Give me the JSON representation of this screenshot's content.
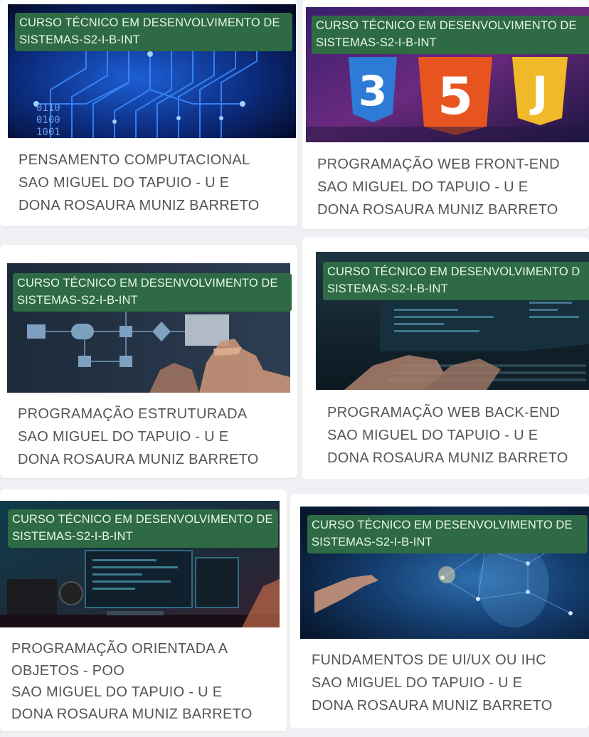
{
  "courses": [
    {
      "badge_line1": "CURSO TÉCNICO EM DESENVOLVIMENTO DE",
      "badge_line2": "SISTEMAS-S2-I-B-INT",
      "title": "PENSAMENTO COMPUTACIONAL",
      "school_line1": "SAO MIGUEL DO TAPUIO - U E",
      "school_line2": "DONA ROSAURA MUNIZ BARRETO",
      "image_overlay_text": "0110 0100 1001",
      "image_icon": "circuit-board-image"
    },
    {
      "badge_line1": "CURSO TÉCNICO EM DESENVOLVIMENTO DE",
      "badge_line2": "SISTEMAS-S2-I-B-INT",
      "title": "PROGRAMAÇÃO WEB FRONT-END",
      "school_line1": "SAO MIGUEL DO TAPUIO - U E",
      "school_line2": "DONA ROSAURA MUNIZ BARRETO",
      "logo_css": "3",
      "logo_html": "5",
      "logo_js": "J",
      "image_icon": "html-css-js-logos-image"
    },
    {
      "badge_line1": "CURSO TÉCNICO EM DESENVOLVIMENTO DE",
      "badge_line2": "SISTEMAS-S2-I-B-INT",
      "title": "PROGRAMAÇÃO ESTRUTURADA",
      "school_line1": "SAO MIGUEL DO TAPUIO - U E",
      "school_line2": "DONA ROSAURA MUNIZ BARRETO",
      "image_icon": "flowchart-hand-image"
    },
    {
      "badge_line1": "CURSO TÉCNICO EM DESENVOLVIMENTO D",
      "badge_line2": "SISTEMAS-S2-I-B-INT",
      "title": "PROGRAMAÇÃO WEB BACK-END",
      "school_line1": "SAO MIGUEL DO TAPUIO - U E",
      "school_line2": "DONA ROSAURA MUNIZ BARRETO",
      "image_icon": "keyboard-monitor-image"
    },
    {
      "badge_line1": "CURSO TÉCNICO EM DESENVOLVIMENTO DE",
      "badge_line2": "SISTEMAS-S2-I-B-INT",
      "title_line1": "PROGRAMAÇÃO ORIENTADA A",
      "title_line2": "OBJETOS - POO",
      "school_line1": "SAO MIGUEL DO TAPUIO - U E",
      "school_line2": "DONA ROSAURA MUNIZ BARRETO",
      "image_icon": "developer-desk-image"
    },
    {
      "badge_line1": "CURSO TÉCNICO EM DESENVOLVIMENTO DE",
      "badge_line2": "SISTEMAS-S2-I-B-INT",
      "title": "FUNDAMENTOS DE UI/UX OU IHC",
      "school_line1": "SAO MIGUEL DO TAPUIO - U E",
      "school_line2": "DONA ROSAURA MUNIZ BARRETO",
      "image_icon": "ai-touch-image"
    }
  ],
  "colors": {
    "badge_bg": "#2e6b44",
    "badge_text": "#e9f5ec",
    "card_text": "#555555",
    "page_bg": "#eef0f3"
  }
}
